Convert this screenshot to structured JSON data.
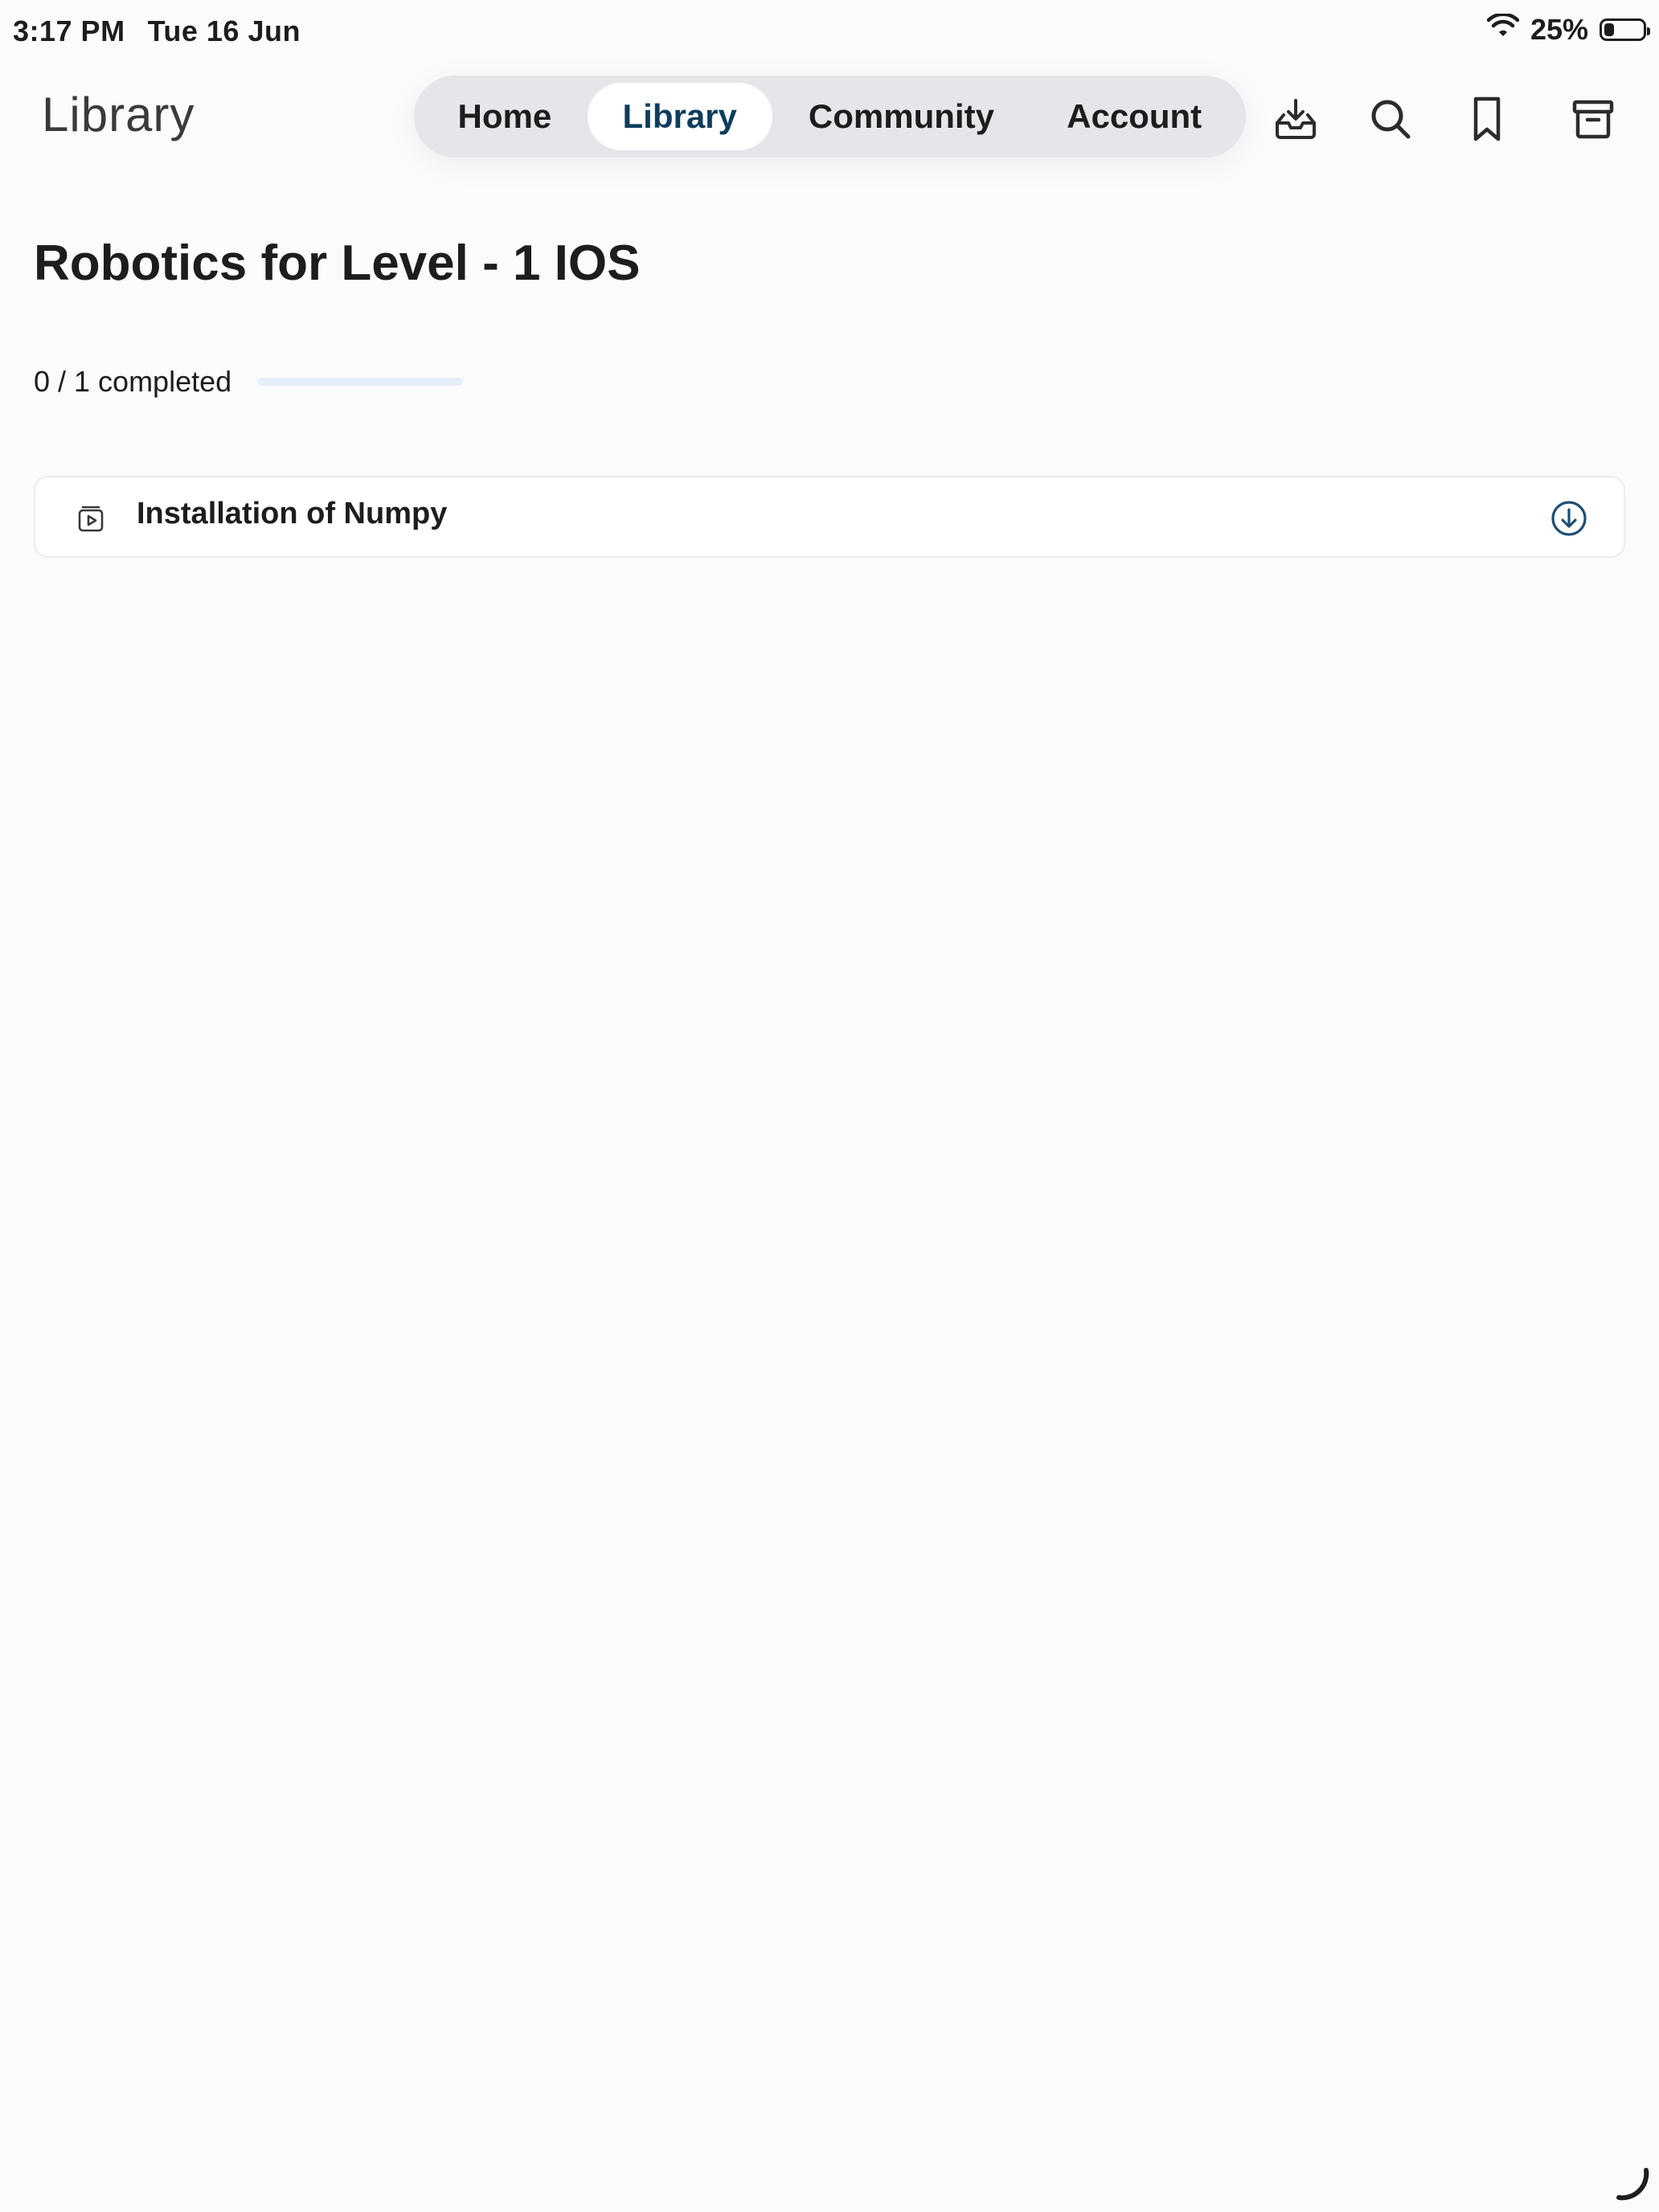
{
  "status_bar": {
    "time": "3:17 PM",
    "date": "Tue 16 Jun",
    "battery_percent": "25%",
    "battery_level": 0.25
  },
  "header": {
    "title": "Library",
    "tabs": [
      {
        "label": "Home",
        "active": false
      },
      {
        "label": "Library",
        "active": true
      },
      {
        "label": "Community",
        "active": false
      },
      {
        "label": "Account",
        "active": false
      }
    ],
    "actions": [
      "download-tray-icon",
      "search-icon",
      "bookmark-icon",
      "archive-icon"
    ]
  },
  "course": {
    "title": "Robotics for Level - 1 IOS",
    "progress_text": "0 / 1 completed",
    "progress_fraction": 0,
    "lessons": [
      {
        "label": "Installation of Numpy",
        "icon": "video-lesson-icon",
        "action_icon": "download-circle-icon"
      }
    ]
  },
  "colors": {
    "accent": "#0f3d5c",
    "background": "#fbfbfe",
    "tabbar": "#e5e5ea",
    "progress_track": "#e6eef9"
  }
}
